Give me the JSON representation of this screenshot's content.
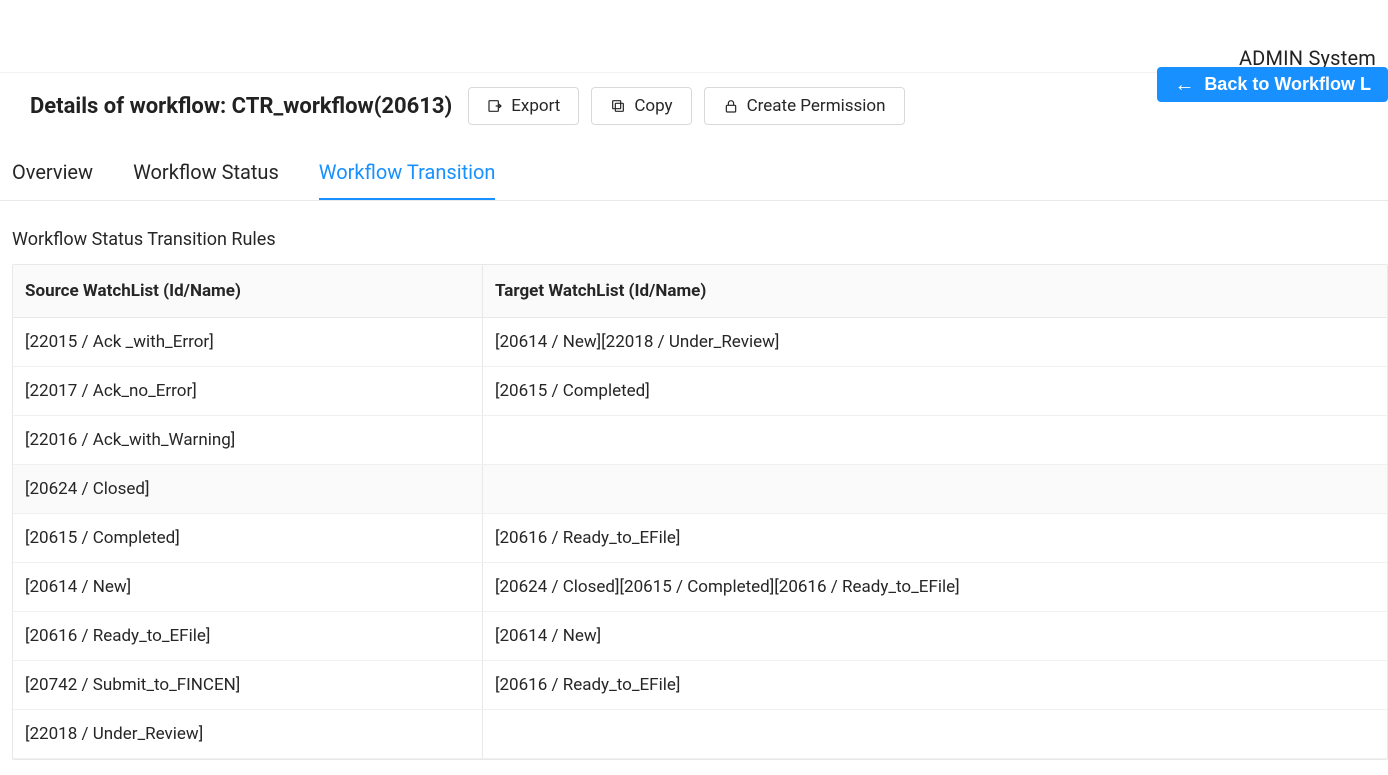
{
  "user": "ADMIN System",
  "header": {
    "title": "Details of workflow: CTR_workflow(20613)",
    "buttons": {
      "export": "Export",
      "copy": "Copy",
      "create_permission": "Create Permission"
    },
    "back_button": "Back to Workflow L"
  },
  "tabs": {
    "overview": "Overview",
    "workflow_status": "Workflow Status",
    "workflow_transition": "Workflow Transition"
  },
  "section_title": "Workflow Status Transition Rules",
  "table": {
    "columns": {
      "source": "Source WatchList (Id/Name)",
      "target": "Target WatchList (Id/Name)"
    },
    "rows": [
      {
        "source": "[22015 / Ack _with_Error]",
        "target": "[20614 / New][22018 / Under_Review]"
      },
      {
        "source": "[22017 / Ack_no_Error]",
        "target": "[20615 / Completed]"
      },
      {
        "source": "[22016 / Ack_with_Warning]",
        "target": ""
      },
      {
        "source": "[20624 / Closed]",
        "target": ""
      },
      {
        "source": "[20615 / Completed]",
        "target": "[20616 / Ready_to_EFile]"
      },
      {
        "source": "[20614 / New]",
        "target": "[20624 / Closed][20615 / Completed][20616 / Ready_to_EFile]"
      },
      {
        "source": "[20616 / Ready_to_EFile]",
        "target": "[20614 / New]"
      },
      {
        "source": "[20742 / Submit_to_FINCEN]",
        "target": "[20616 / Ready_to_EFile]"
      },
      {
        "source": "[22018 / Under_Review]",
        "target": ""
      }
    ]
  }
}
